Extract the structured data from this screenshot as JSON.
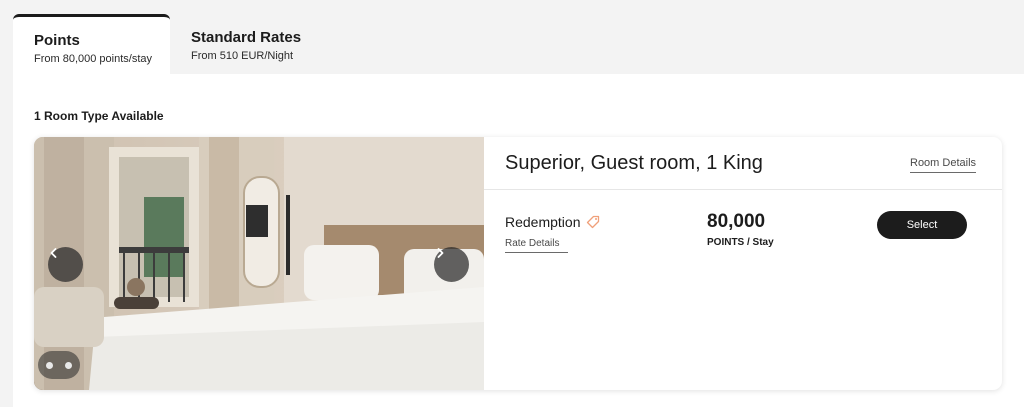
{
  "tabs": [
    {
      "title": "Points",
      "subtitle": "From 80,000 points/stay",
      "active": true
    },
    {
      "title": "Standard Rates",
      "subtitle": "From 510 EUR/Night",
      "active": false
    }
  ],
  "room_count_label": "1 Room Type Available",
  "room": {
    "name": "Superior, Guest room, 1 King",
    "details_link": "Room Details",
    "carousel": {
      "prev_icon": "chevron-left-icon",
      "next_icon": "chevron-right-icon",
      "dot_count": 2
    },
    "rate": {
      "name": "Redemption",
      "tag_icon": "tag-icon",
      "details_link": "Rate Details",
      "price": "80,000",
      "price_unit": "POINTS / Stay",
      "select_label": "Select"
    }
  },
  "colors": {
    "accent_tag": "#f0a07a",
    "button_dark": "#1c1c1c",
    "page_bg": "#f3f3f3"
  }
}
